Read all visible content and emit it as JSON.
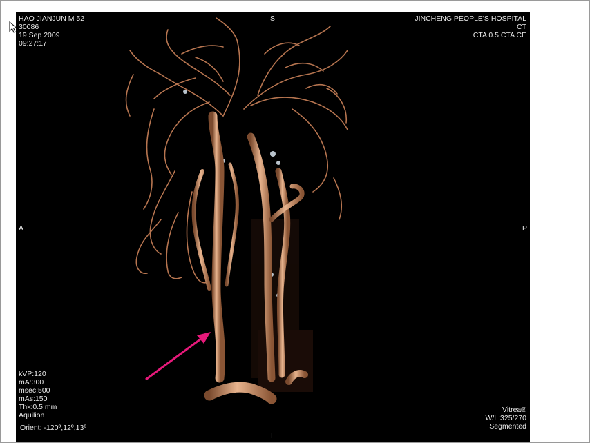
{
  "patient": {
    "name_line": "HAO JIANJUN M 52",
    "id_line": "30086",
    "date": "19 Sep 2009",
    "time": "09:27:17"
  },
  "institution": {
    "hospital": "JINCHENG PEOPLE'S HOSPITAL",
    "modality": "CT",
    "series": "CTA 0.5 CTA CE"
  },
  "orientation": {
    "top": "S",
    "left": "A",
    "right": "P",
    "bottom": "I"
  },
  "scan_params": {
    "kvp": "kVP:120",
    "ma": "mA:300",
    "msec": "msec:500",
    "mas": "mAs:150",
    "thk": "Thk:0.5 mm",
    "scanner": "Aquilion",
    "orient": "Orient: -120º,12º,13º"
  },
  "render_info": {
    "software": "Vitrea®",
    "window_level": "W/L:325/270",
    "mode": "Segmented"
  },
  "colors": {
    "background": "#000000",
    "vessel": "#c98a63",
    "vessel_highlight": "#e8b48e",
    "calcification": "#b9c3cc",
    "annotation_arrow": "#e6197a",
    "overlay_text": "#e8e8e8"
  },
  "icons": {
    "cursor": "move-cursor-icon",
    "arrow": "annotation-arrow"
  }
}
